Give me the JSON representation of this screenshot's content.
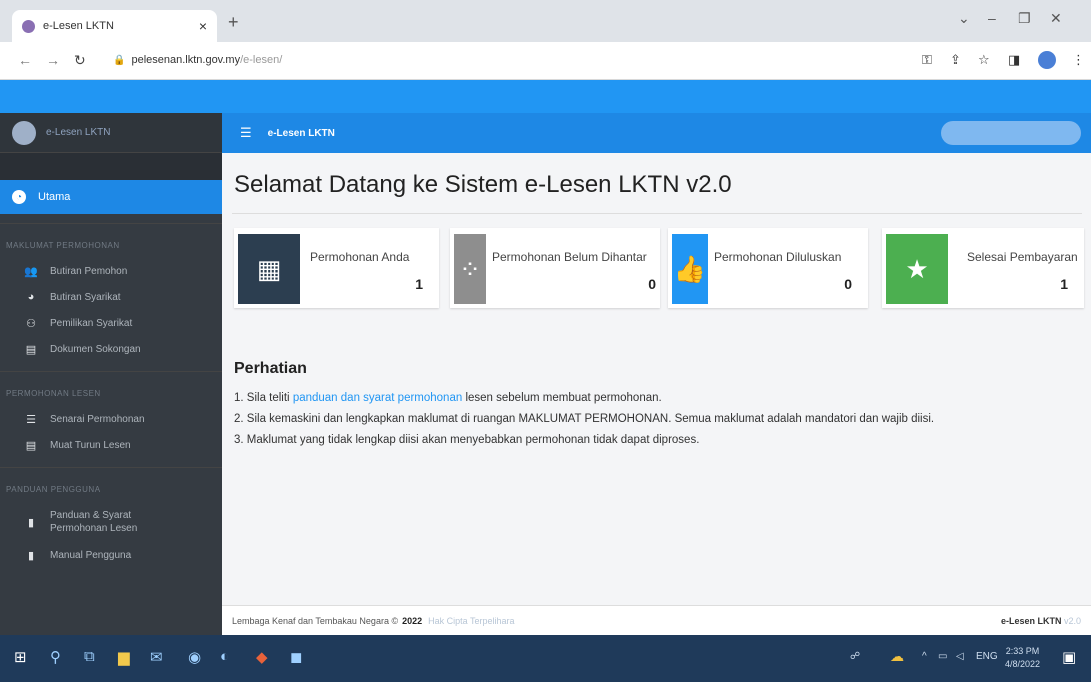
{
  "browser": {
    "tab_title": "e-Lesen LKTN",
    "tab_close": "×",
    "new_tab": "+",
    "url_host": "pelesenan.lktn.gov.my",
    "url_path": "/e-lesen/"
  },
  "sidebar": {
    "brand": "e-Lesen LKTN",
    "active_item": "Utama",
    "section1": "MAKLUMAT PERMOHONAN",
    "section1_items": [
      "Butiran Pemohon",
      "Butiran Syarikat",
      "Pemilikan Syarikat",
      "Dokumen Sokongan"
    ],
    "section2": "PERMOHONAN LESEN",
    "section2_items": [
      "Senarai Permohonan",
      "Muat Turun Lesen"
    ],
    "section3": "PANDUAN PENGGUNA",
    "section3_items": [
      "Panduan & Syarat Permohonan Lesen",
      "Manual Pengguna"
    ]
  },
  "header": {
    "title": "e-Lesen LKTN"
  },
  "main": {
    "page_title": "Selamat Datang ke Sistem e-Lesen LKTN v2.0",
    "cards": [
      {
        "label": "Permohonan Anda",
        "value": "1",
        "color": "#2c3e50"
      },
      {
        "label": "Permohonan Belum Dihantar",
        "value": "0",
        "color": "#8e8e8e"
      },
      {
        "label": "Permohonan Diluluskan",
        "value": "0",
        "color": "#2196f3"
      },
      {
        "label": "Selesai Pembayaran",
        "value": "1",
        "color": "#4caf50"
      }
    ],
    "notice_title": "Perhatian",
    "note1_pre": "1. Sila teliti ",
    "note1_link": "panduan dan syarat permohonan",
    "note1_post": " lesen sebelum membuat permohonan.",
    "note2": "2. Sila kemaskini dan lengkapkan maklumat di ruangan MAKLUMAT PERMOHONAN. Semua maklumat adalah mandatori dan wajib diisi.",
    "note3": "3. Maklumat yang tidak lengkap diisi akan menyebabkan permohonan tidak dapat diproses."
  },
  "footer": {
    "org": "Lembaga Kenaf dan Tembakau Negara ©",
    "year": "2022",
    "rights": "Hak Cipta Terpelihara",
    "app": "e-Lesen LKTN",
    "version": "v2.0"
  },
  "taskbar": {
    "lang": "ENG",
    "time": "2:33 PM",
    "date": "4/8/2022"
  }
}
